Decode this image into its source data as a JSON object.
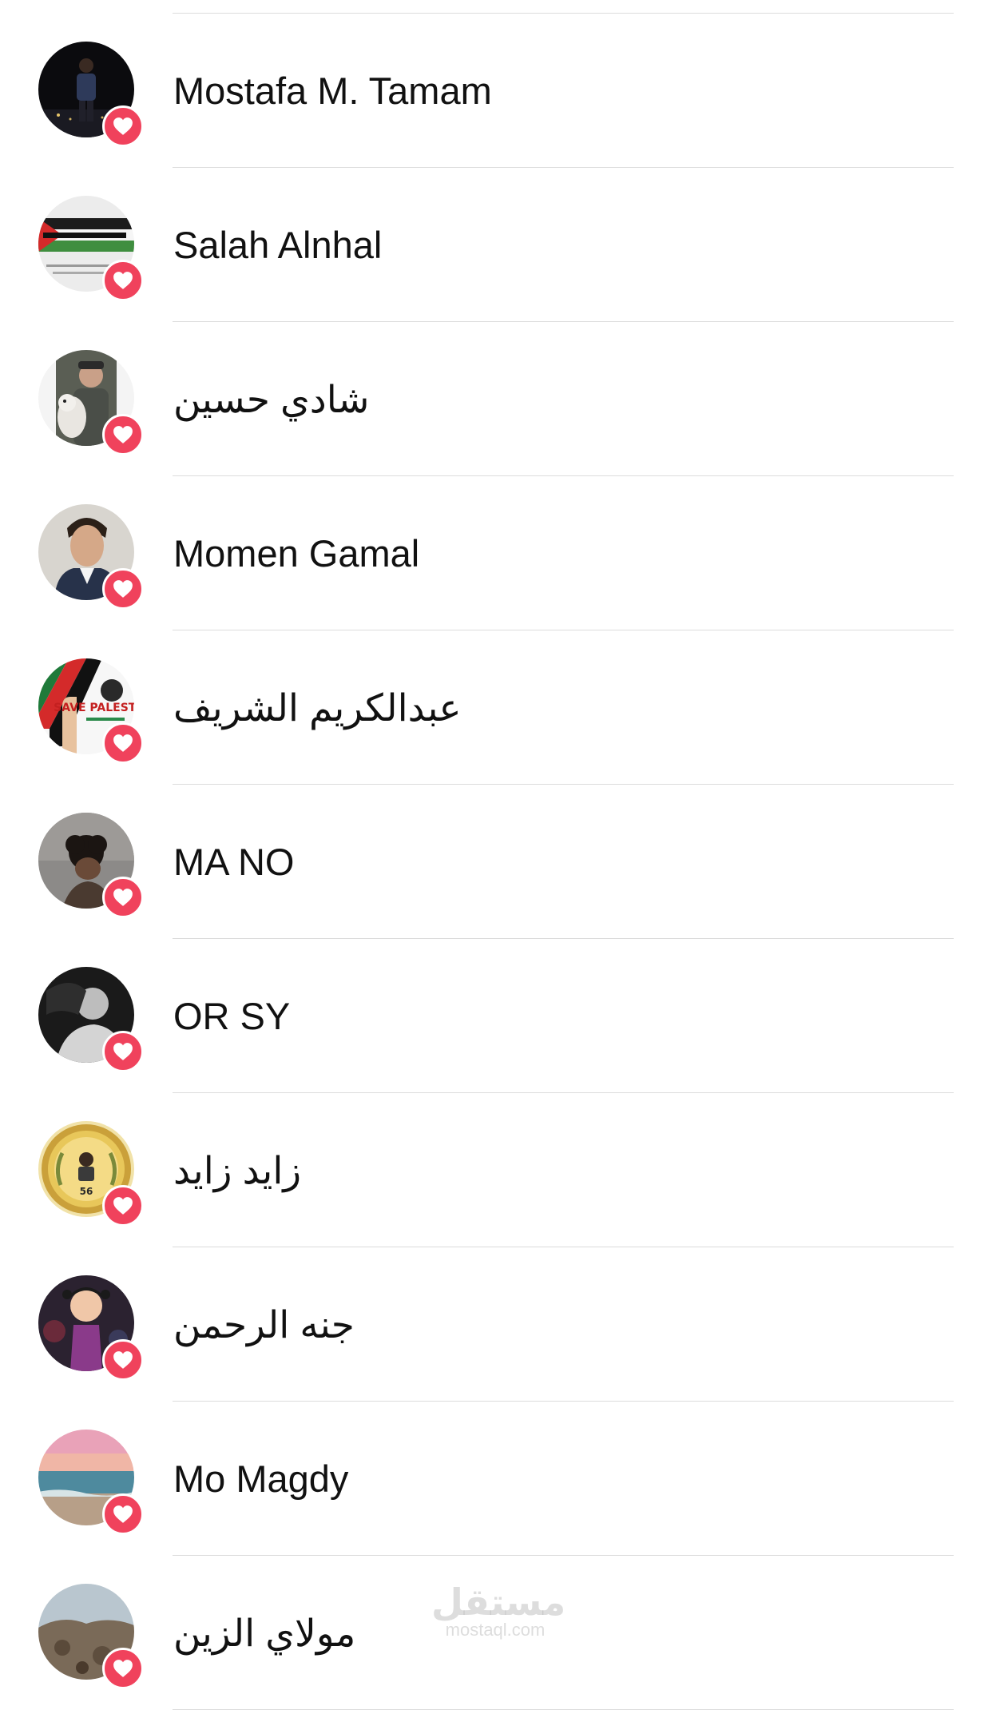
{
  "reactions_list": {
    "reaction_icon": "heart-icon",
    "reaction_color": "#f0425c",
    "people": [
      {
        "name": "Mostafa M. Tamam",
        "avatar_icon": "night-photo-avatar"
      },
      {
        "name": "Salah Alnhal",
        "avatar_icon": "palestine-flag-avatar"
      },
      {
        "name": "شادي حسين",
        "avatar_icon": "man-with-dog-avatar"
      },
      {
        "name": "Momen Gamal",
        "avatar_icon": "portrait-avatar"
      },
      {
        "name": "عبدالكريم الشريف",
        "avatar_icon": "save-palestine-avatar",
        "avatar_text": "SAVE PALESTINE"
      },
      {
        "name": "MA NO",
        "avatar_icon": "curly-hair-avatar"
      },
      {
        "name": "OR SY",
        "avatar_icon": "bw-portrait-avatar"
      },
      {
        "name": "زايد زايد",
        "avatar_icon": "gold-medal-avatar",
        "avatar_text": "56"
      },
      {
        "name": "جنه الرحمن",
        "avatar_icon": "cartoon-avatar"
      },
      {
        "name": "Mo Magdy",
        "avatar_icon": "sunset-sea-avatar"
      },
      {
        "name": "مولاي الزين",
        "avatar_icon": "landscape-avatar"
      }
    ]
  },
  "watermark": {
    "arabic": "مستقل",
    "latin": "mostaql.com"
  }
}
